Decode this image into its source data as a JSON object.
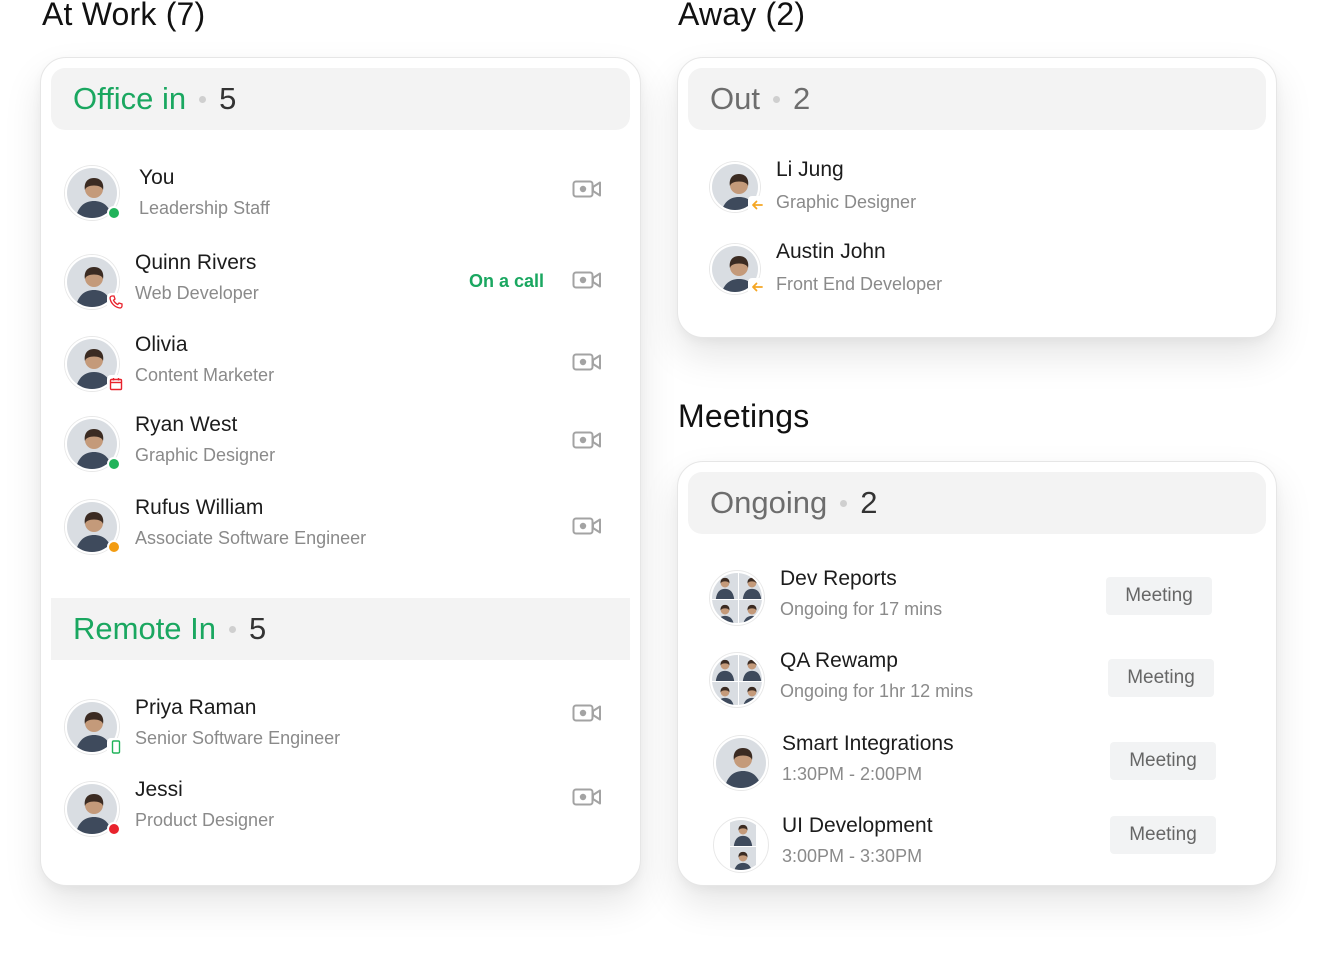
{
  "at_work": {
    "title": "At Work (7)",
    "office_in": {
      "label": "Office in",
      "count": "5",
      "people": [
        {
          "name": "You",
          "role": "Leadership Staff",
          "status": "online",
          "on_call": false
        },
        {
          "name": "Quinn Rivers",
          "role": "Web Developer",
          "status": "call",
          "on_call": true
        },
        {
          "name": "Olivia",
          "role": "Content Marketer",
          "status": "calendar",
          "on_call": false
        },
        {
          "name": "Ryan West",
          "role": "Graphic Designer",
          "status": "online",
          "on_call": false
        },
        {
          "name": "Rufus William",
          "role": "Associate Software Engineer",
          "status": "away",
          "on_call": false
        }
      ]
    },
    "on_call_label": "On a call",
    "remote_in": {
      "label": "Remote In",
      "count": "5",
      "people": [
        {
          "name": "Priya Raman",
          "role": "Senior Software Engineer",
          "status": "mobile"
        },
        {
          "name": "Jessi",
          "role": "Product Designer",
          "status": "busy"
        }
      ]
    }
  },
  "away": {
    "title": "Away (2)",
    "out": {
      "label": "Out",
      "count": "2",
      "people": [
        {
          "name": "Li Jung",
          "role": "Graphic Designer"
        },
        {
          "name": "Austin John",
          "role": "Front End Developer"
        }
      ]
    }
  },
  "meetings": {
    "title": "Meetings",
    "ongoing": {
      "label": "Ongoing",
      "count": "2",
      "items": [
        {
          "title": "Dev Reports",
          "detail": "Ongoing for 17 mins",
          "button": "Meeting"
        },
        {
          "title": "QA Rewamp",
          "detail": "Ongoing for 1hr 12 mins",
          "button": "Meeting"
        },
        {
          "title": "Smart Integrations",
          "detail": "1:30PM - 2:00PM",
          "button": "Meeting"
        },
        {
          "title": "UI Development",
          "detail": "3:00PM - 3:30PM",
          "button": "Meeting"
        }
      ]
    }
  },
  "colors": {
    "accent_green": "#1aa760",
    "online": "#21b35a",
    "away": "#f39c12",
    "busy": "#e8222c",
    "out_arrow": "#f5a623"
  },
  "icons": {
    "video": "video-camera-icon",
    "phone": "phone-icon",
    "calendar": "calendar-icon",
    "mobile": "mobile-icon",
    "out": "arrow-left-icon"
  }
}
